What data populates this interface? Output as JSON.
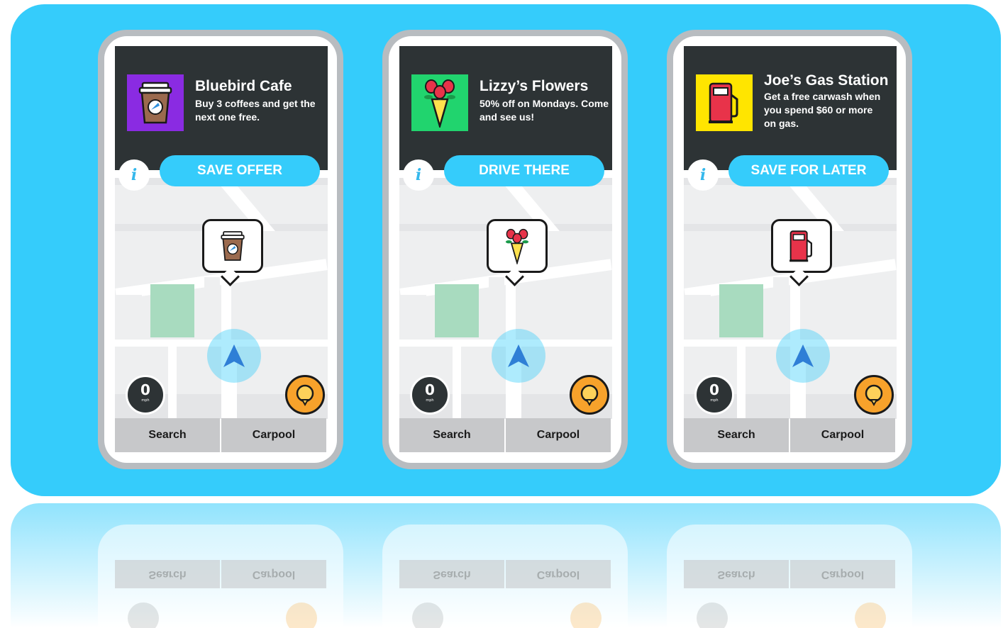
{
  "phones": [
    {
      "name": "Bluebird Cafe",
      "description": "Buy 3 coffees and get the next one free.",
      "cta": "SAVE OFFER",
      "logo_bg": "#8a2be2",
      "icon": "coffee-cup-icon"
    },
    {
      "name": "Lizzy’s Flowers",
      "description": "50% off on Mondays. Come and see us!",
      "cta": "DRIVE THERE",
      "logo_bg": "#21d46e",
      "icon": "flower-bouquet-icon"
    },
    {
      "name": "Joe’s Gas Station",
      "description": "Get a free carwash when you spend $60 or more on gas.",
      "cta": "SAVE FOR LATER",
      "logo_bg": "#ffe500",
      "icon": "gas-pump-icon"
    }
  ],
  "common": {
    "info_label": "i",
    "speed_value": "0",
    "speed_unit": "mph",
    "search_label": "Search",
    "carpool_label": "Carpool"
  },
  "colors": {
    "banner": "#35ccfb",
    "card": "#2d3335",
    "cta": "#35ccfb",
    "report_button": "#f7a22b"
  }
}
